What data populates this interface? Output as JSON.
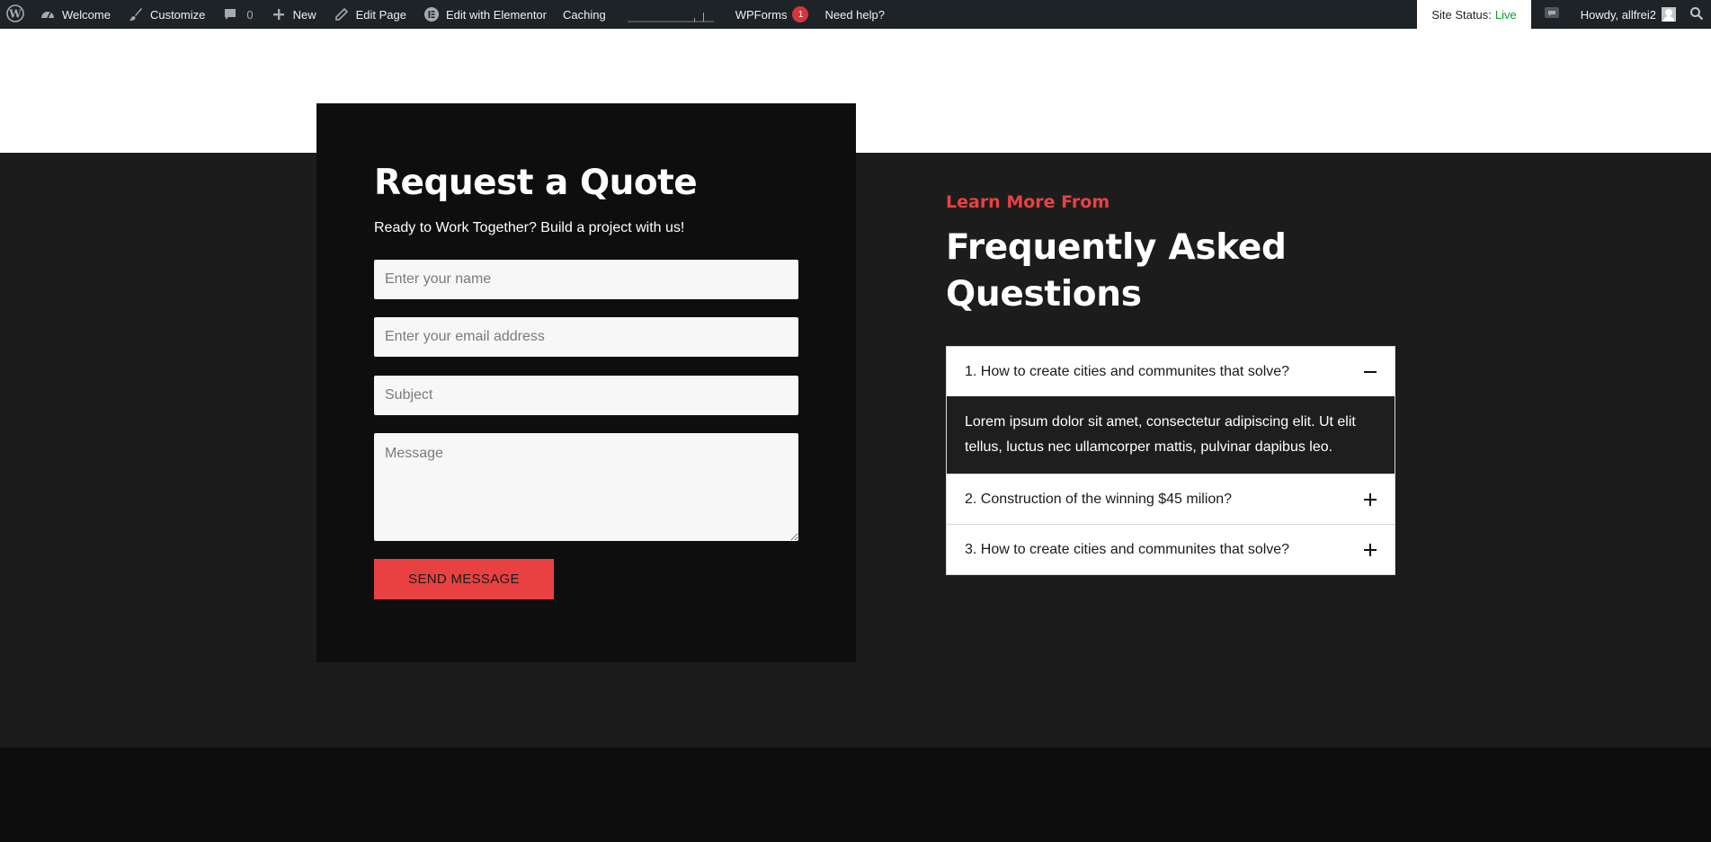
{
  "adminbar": {
    "welcome": "Welcome",
    "customize": "Customize",
    "comments_count": "0",
    "new": "New",
    "edit_page": "Edit Page",
    "edit_elementor": "Edit with Elementor",
    "caching": "Caching",
    "wpforms": "WPForms",
    "wpforms_badge": "1",
    "need_help": "Need help?",
    "site_status_label": "Site Status:",
    "site_status_value": "Live",
    "howdy": "Howdy, allfrei2"
  },
  "quote": {
    "title": "Request a Quote",
    "subtitle": "Ready to Work Together? Build a project with us!",
    "name_placeholder": "Enter your name",
    "email_placeholder": "Enter your email address",
    "subject_placeholder": "Subject",
    "message_placeholder": "Message",
    "send_label": "SEND MESSAGE"
  },
  "faq": {
    "eyebrow": "Learn More From",
    "title": "Frequently Asked Questions",
    "items": [
      {
        "question": "1. How to create cities and communites that solve?",
        "answer": "Lorem ipsum dolor sit amet, consectetur adipiscing elit. Ut elit tellus, luctus nec ullamcorper mattis, pulvinar dapibus leo.",
        "expanded": true
      },
      {
        "question": "2. Construction of the winning $45 milion?",
        "expanded": false
      },
      {
        "question": "3. How to create cities and communites that solve?",
        "expanded": false
      }
    ]
  },
  "colors": {
    "accent": "#e94141",
    "adminbar_bg": "#1d2327",
    "dark_band": "#1c1c1d",
    "card_bg": "#0e0e0f",
    "footer_bg": "#0d0d0e",
    "status_live": "#00a32a"
  }
}
